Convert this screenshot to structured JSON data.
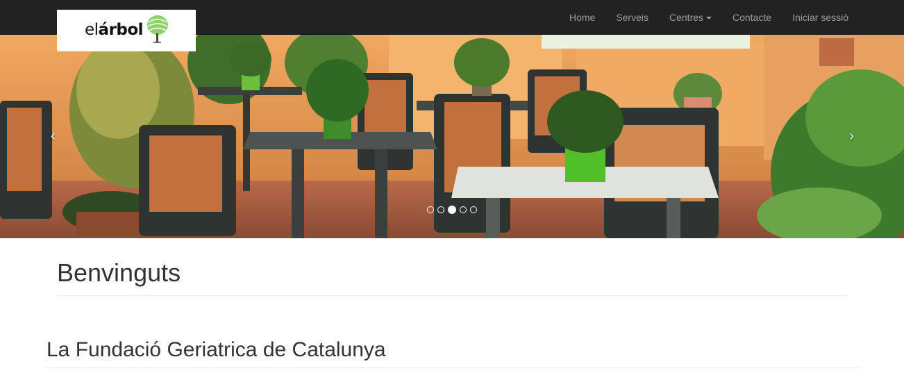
{
  "brand": {
    "logo_el": "el",
    "logo_arbol": "árbol"
  },
  "nav": {
    "items": [
      {
        "label": "Home"
      },
      {
        "label": "Serveis"
      },
      {
        "label": "Centres",
        "dropdown": true
      },
      {
        "label": "Contacte"
      },
      {
        "label": "Iniciar sessió"
      }
    ]
  },
  "carousel": {
    "prev_label": "‹",
    "next_label": "›",
    "slide_count": 5,
    "active_index": 2
  },
  "content": {
    "page_title": "Benvinguts",
    "section_title": "La Fundació Geriatrica de Catalunya"
  },
  "colors": {
    "navbar_bg": "#222222",
    "nav_link": "#9d9d9d",
    "logo_green": "#6abf3b"
  }
}
